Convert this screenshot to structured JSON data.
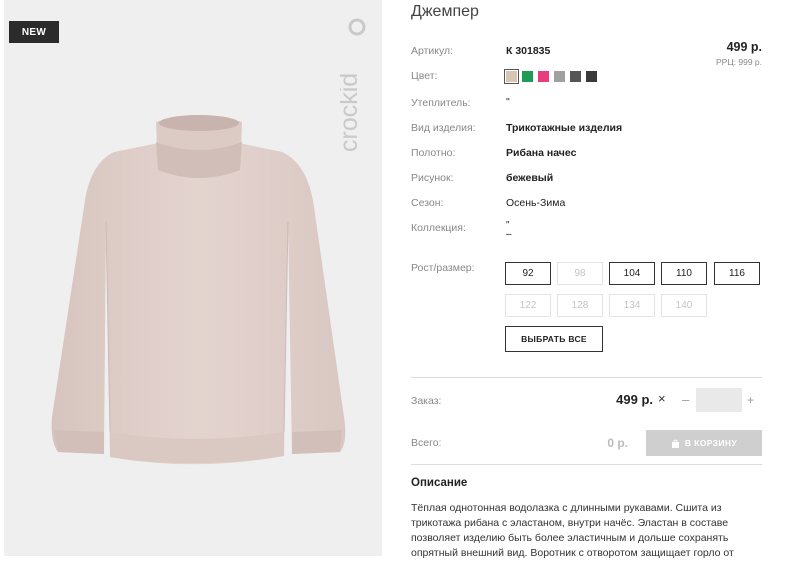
{
  "badge": "NEW",
  "brand": "crockid",
  "product": {
    "title": "Джемпер",
    "sku_label": "Артикул:",
    "sku": "К 301835",
    "price": "499 р.",
    "rrp": "РРЦ: 999 р.",
    "color_label": "Цвет:",
    "colors": [
      "#d8c6b4",
      "#1f9a57",
      "#e83e80",
      "#a0a0a0",
      "#555555",
      "#3a3a3a"
    ],
    "insulation_label": "Утеплитель:",
    "insulation": "\"",
    "type_label": "Вид изделия:",
    "type": "Трикотажные изделия",
    "fabric_label": "Полотно:",
    "fabric": "Рибана начес",
    "pattern_label": "Рисунок:",
    "pattern": "бежевый",
    "season_label": "Сезон:",
    "season": "Осень-Зима",
    "collection_label": "Коллекция:",
    "collection": "\"",
    "collection_extra": "–"
  },
  "sizes": {
    "label": "Рост/размер:",
    "row1": [
      "92",
      "98",
      "104",
      "110",
      "116"
    ],
    "row2": [
      "122",
      "128",
      "134",
      "140"
    ],
    "select_all": "ВЫБРАТЬ ВСЕ"
  },
  "order": {
    "label": "Заказ:",
    "price": "499 р.",
    "times": "×",
    "minus": "–",
    "plus": "+",
    "qty": "",
    "total_label": "Всего:",
    "total": "0 р.",
    "cart_button": "В КОРЗИНУ"
  },
  "description": {
    "title": "Описание",
    "text": "Тёплая однотонная водолазка с длинными рукавами. Сшита из трикотажа рибана с эластаном, внутри начёс. Эластан в составе позволяет изделию быть более эластичным и дольше сохранять опрятный внешний вид. Воротник с отворотом защищает горло от"
  }
}
